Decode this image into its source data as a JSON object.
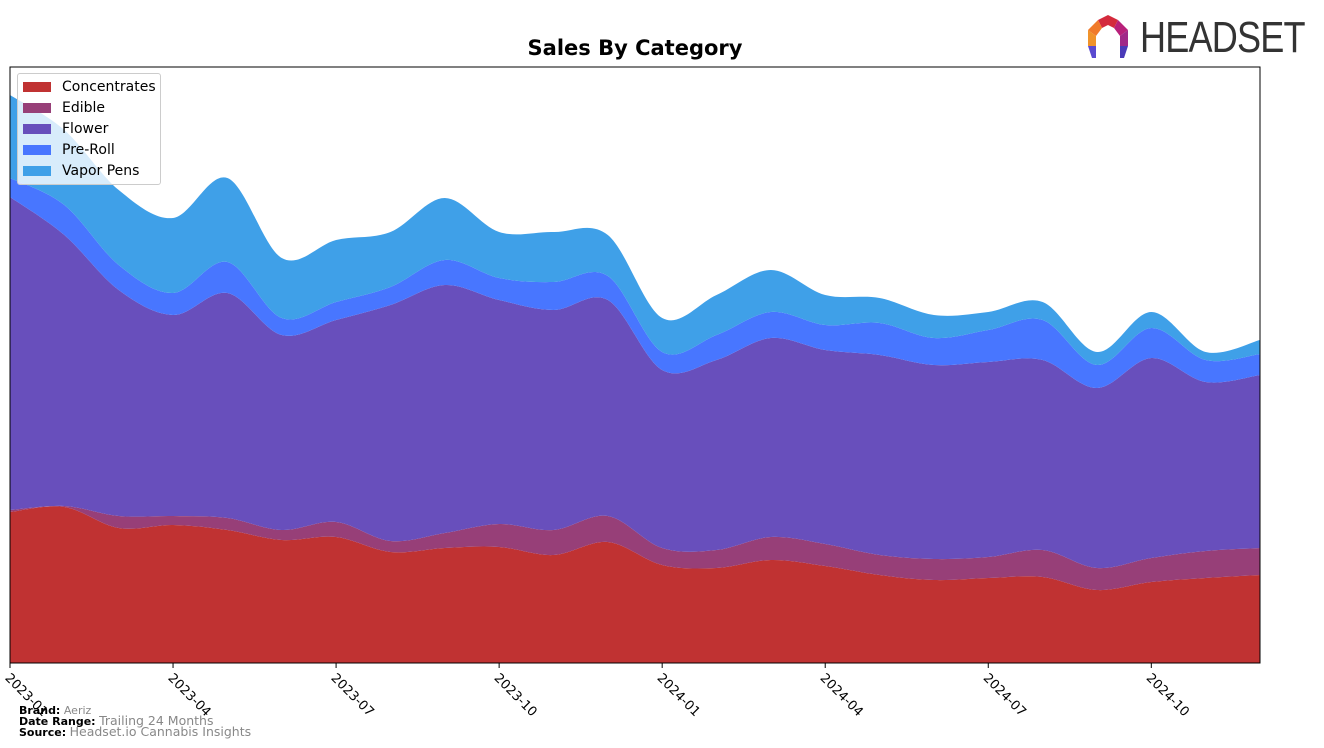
{
  "header": {
    "title": "Sales By Category",
    "logo_text": "HEADSET"
  },
  "footer": {
    "brand_label": "Brand:",
    "brand_value": "Aeriz",
    "date_range_label": "Date Range:",
    "date_range_value": "Trailing 24 Months",
    "source_label": "Source:",
    "source_value": "Headset.io Cannabis Insights"
  },
  "chart_data": {
    "type": "area",
    "stacked": true,
    "title": "Sales By Category",
    "xlabel": "",
    "ylabel": "",
    "y_axis_labels_shown": false,
    "units": "relative (no y-axis scale shown)",
    "grid": false,
    "legend_position": "top-left",
    "x": [
      "2023-01",
      "2023-02",
      "2023-03",
      "2023-04",
      "2023-05",
      "2023-06",
      "2023-07",
      "2023-08",
      "2023-09",
      "2023-10",
      "2023-11",
      "2023-12",
      "2024-01",
      "2024-02",
      "2024-03",
      "2024-04",
      "2024-05",
      "2024-06",
      "2024-07",
      "2024-08",
      "2024-09",
      "2024-10",
      "2024-11",
      "2024-12"
    ],
    "x_tick_labels": [
      "2023-01",
      "2023-04",
      "2023-07",
      "2023-10",
      "2024-01",
      "2024-04",
      "2024-07",
      "2024-10"
    ],
    "ylim": [
      0,
      596
    ],
    "series": [
      {
        "name": "Concentrates",
        "color": "#c03232",
        "values": [
          151,
          156,
          135,
          138,
          133,
          123,
          126,
          111,
          115,
          116,
          108,
          121,
          98,
          95,
          103,
          97,
          88,
          83,
          85,
          86,
          73,
          81,
          85,
          88
        ]
      },
      {
        "name": "Edible",
        "color": "#973f78",
        "values": [
          2,
          1,
          12,
          9,
          12,
          10,
          15,
          11,
          15,
          23,
          25,
          26,
          17,
          18,
          23,
          22,
          20,
          21,
          21,
          27,
          22,
          24,
          27,
          27
        ]
      },
      {
        "name": "Flower",
        "color": "#684fbc",
        "values": [
          313,
          271,
          226,
          201,
          225,
          195,
          202,
          236,
          248,
          224,
          220,
          216,
          178,
          190,
          199,
          194,
          200,
          194,
          195,
          190,
          180,
          200,
          169,
          173
        ]
      },
      {
        "name": "Pre-Roll",
        "color": "#4876ff",
        "values": [
          19,
          30,
          25,
          22,
          31,
          17,
          18,
          18,
          25,
          22,
          28,
          24,
          18,
          25,
          26,
          25,
          32,
          27,
          32,
          40,
          23,
          30,
          22,
          21
        ]
      },
      {
        "name": "Vapor Pens",
        "color": "#3fa0e8",
        "values": [
          83,
          75,
          75,
          75,
          84,
          60,
          62,
          55,
          62,
          46,
          50,
          41,
          34,
          40,
          42,
          30,
          25,
          23,
          18,
          18,
          13,
          16,
          8,
          14
        ]
      }
    ]
  }
}
